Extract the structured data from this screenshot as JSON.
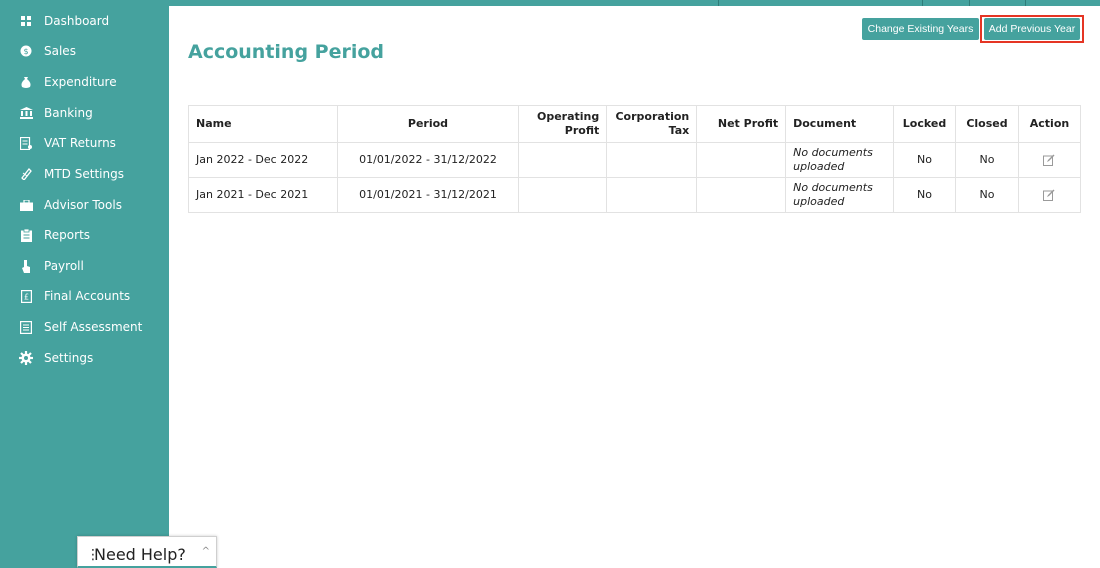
{
  "sidebar": {
    "items": [
      {
        "label": "Dashboard",
        "icon": "dashboard-icon"
      },
      {
        "label": "Sales",
        "icon": "sales-icon"
      },
      {
        "label": "Expenditure",
        "icon": "money-bag-icon"
      },
      {
        "label": "Banking",
        "icon": "bank-icon"
      },
      {
        "label": "VAT Returns",
        "icon": "vat-returns-icon"
      },
      {
        "label": "MTD Settings",
        "icon": "mtd-settings-icon"
      },
      {
        "label": "Advisor Tools",
        "icon": "briefcase-icon"
      },
      {
        "label": "Reports",
        "icon": "reports-icon"
      },
      {
        "label": "Payroll",
        "icon": "payroll-icon"
      },
      {
        "label": "Final Accounts",
        "icon": "final-accounts-icon"
      },
      {
        "label": "Self Assessment",
        "icon": "self-assessment-icon"
      },
      {
        "label": "Settings",
        "icon": "gear-icon"
      }
    ]
  },
  "page": {
    "title": "Accounting Period"
  },
  "toolbar": {
    "change_existing_years": "Change Existing Years",
    "add_previous_year": "Add Previous Year"
  },
  "table": {
    "headers": {
      "name": "Name",
      "period": "Period",
      "operating_profit": "Operating Profit",
      "corporation_tax": "Corporation Tax",
      "net_profit": "Net Profit",
      "document": "Document",
      "locked": "Locked",
      "closed": "Closed",
      "action": "Action"
    },
    "rows": [
      {
        "name": "Jan 2022 - Dec 2022",
        "period": "01/01/2022 - 31/12/2022",
        "operating_profit": "",
        "corporation_tax": "",
        "net_profit": "",
        "document": "No documents uploaded",
        "locked": "No",
        "closed": "No",
        "action_icon": "edit-icon"
      },
      {
        "name": "Jan 2021 - Dec 2021",
        "period": "01/01/2021 - 31/12/2021",
        "operating_profit": "",
        "corporation_tax": "",
        "net_profit": "",
        "document": "No documents uploaded",
        "locked": "No",
        "closed": "No",
        "action_icon": "edit-icon"
      }
    ]
  },
  "help_widget": {
    "label": "Need Help?"
  },
  "colors": {
    "brand_teal": "#45a29e",
    "highlight_red": "#e53524"
  }
}
